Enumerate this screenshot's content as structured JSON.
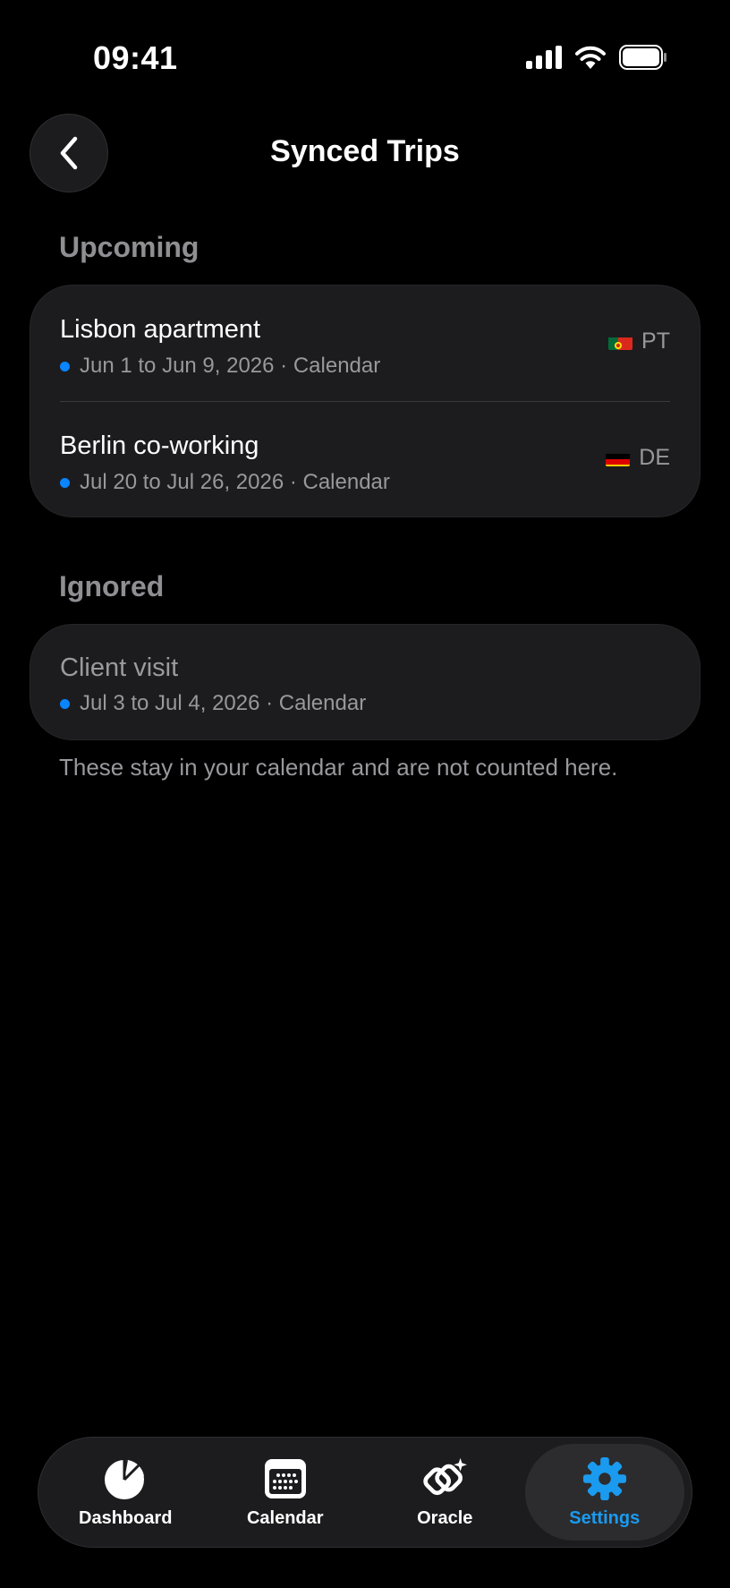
{
  "status_bar": {
    "time": "09:41"
  },
  "header": {
    "title": "Synced Trips"
  },
  "sections": {
    "upcoming": {
      "title": "Upcoming",
      "items": [
        {
          "title": "Lisbon apartment",
          "dates": "Jun 1 to Jun 9, 2026 · Calendar",
          "country": "PT"
        },
        {
          "title": "Berlin co-working",
          "dates": "Jul 20 to Jul 26, 2026 · Calendar",
          "country": "DE"
        }
      ]
    },
    "ignored": {
      "title": "Ignored",
      "items": [
        {
          "title": "Client visit",
          "dates": "Jul 3 to Jul 4, 2026 · Calendar"
        }
      ],
      "note": "These stay in your calendar and are not counted here."
    }
  },
  "tabbar": {
    "tabs": [
      {
        "label": "Dashboard",
        "icon": "pie-chart-icon"
      },
      {
        "label": "Calendar",
        "icon": "calendar-icon"
      },
      {
        "label": "Oracle",
        "icon": "oracle-icon"
      },
      {
        "label": "Settings",
        "icon": "gear-icon",
        "active": true
      }
    ]
  },
  "colors": {
    "accent": "#1a9bf0",
    "dot": "#0a84ff",
    "card": "#1c1c1e",
    "background": "#000000"
  }
}
